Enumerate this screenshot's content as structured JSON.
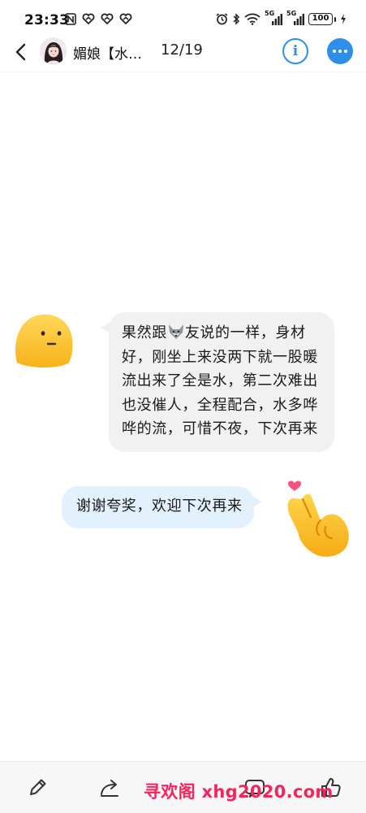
{
  "status_bar": {
    "time": "23:33",
    "battery_level": "100",
    "signal_1_label": "5G",
    "signal_2_label": "5G"
  },
  "header": {
    "contact_name": "媚娘【水…",
    "page_counter": "12/19",
    "info_glyph": "i"
  },
  "messages": [
    {
      "side": "left",
      "sticker": "smiling-face-emoji",
      "text_before_emoji": "果然跟",
      "inline_emoji": "wolf-emoji",
      "text_after_emoji": "友说的一样，身材好，刚坐上来没两下就一股暖流出来了全是水，第二次难出也没催人，全程配合，水多哗哗的流，可惜不夜，下次再来"
    },
    {
      "side": "right",
      "sticker": "finger-heart-emoji",
      "text": "谢谢夸奖，欢迎下次再来"
    }
  ],
  "toolbar": {
    "icons": [
      "edit-icon",
      "share-icon",
      "comment-icon",
      "like-icon"
    ]
  },
  "watermark": "寻欢阁 xhg2020.com",
  "colors": {
    "accent_blue": "#2f8ee8",
    "left_bubble": "#f1f1f2",
    "right_bubble": "#e3f1fd",
    "watermark_pink": "#f5245c",
    "toolbar_bg": "#f7f7f7"
  }
}
